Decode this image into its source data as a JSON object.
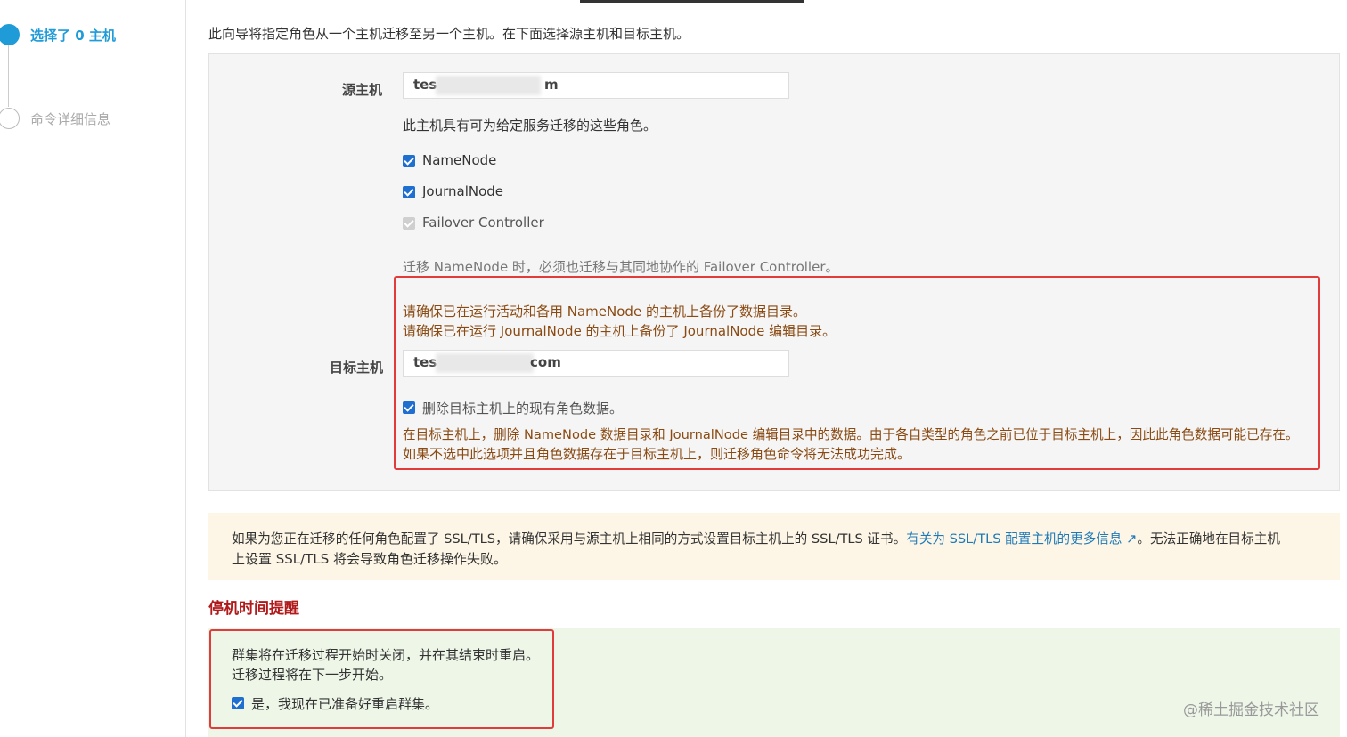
{
  "steps": [
    {
      "label": "选择了 0 主机",
      "active": true
    },
    {
      "label": "命令详细信息",
      "active": false
    }
  ],
  "intro": "此向导将指定角色从一个主机迁移至另一个主机。在下面选择源主机和目标主机。",
  "source": {
    "label": "源主机",
    "value_prefix": "tes",
    "value_suffix": "m",
    "roles_intro": "此主机具有可为给定服务迁移的这些角色。",
    "roles": [
      {
        "label": "NameNode",
        "checked": true,
        "disabled": false
      },
      {
        "label": "JournalNode",
        "checked": true,
        "disabled": false
      },
      {
        "label": "Failover Controller",
        "checked": true,
        "disabled": true
      }
    ],
    "note": "迁移 NameNode 时，必须也迁移与其同地协作的 Failover Controller。"
  },
  "warnings": {
    "line1": "请确保已在运行活动和备用 NameNode 的主机上备份了数据目录。",
    "line2": "请确保已在运行 JournalNode 的主机上备份了 JournalNode 编辑目录。"
  },
  "target": {
    "label": "目标主机",
    "value_prefix": "tes",
    "value_suffix": "com",
    "delete_label": "删除目标主机上的现有角色数据。",
    "delete_checked": true,
    "delete_desc1": "在目标主机上，删除 NameNode 数据目录和 JournalNode 编辑目录中的数据。由于各自类型的角色之前已位于目标主机上，因此此角色数据可能已存在。",
    "delete_desc2": "如果不选中此选项并且角色数据存在于目标主机上，则迁移角色命令将无法成功完成。"
  },
  "ssl": {
    "text1": "如果为您正在迁移的任何角色配置了 SSL/TLS，请确保采用与源主机上相同的方式设置目标主机上的 SSL/TLS 证书。",
    "link": "有关为 SSL/TLS 配置主机的更多信息",
    "text2": "。无法正确地在目标主机",
    "text3": "上设置 SSL/TLS 将会导致角色迁移操作失败。"
  },
  "downtime": {
    "title": "停机时间提醒",
    "line1": "群集将在迁移过程开始时关闭，并在其结束时重启。",
    "line2": "迁移过程将在下一步开始。",
    "confirm_label": "是，我现在已准备好重启群集。",
    "confirm_checked": true
  },
  "watermark": "@稀土掘金技术社区",
  "colors": {
    "accent": "#1f9bd8",
    "warning_text": "#8a4a12",
    "highlight_border": "#e23b3b",
    "downtime_title": "#b11a1a"
  }
}
